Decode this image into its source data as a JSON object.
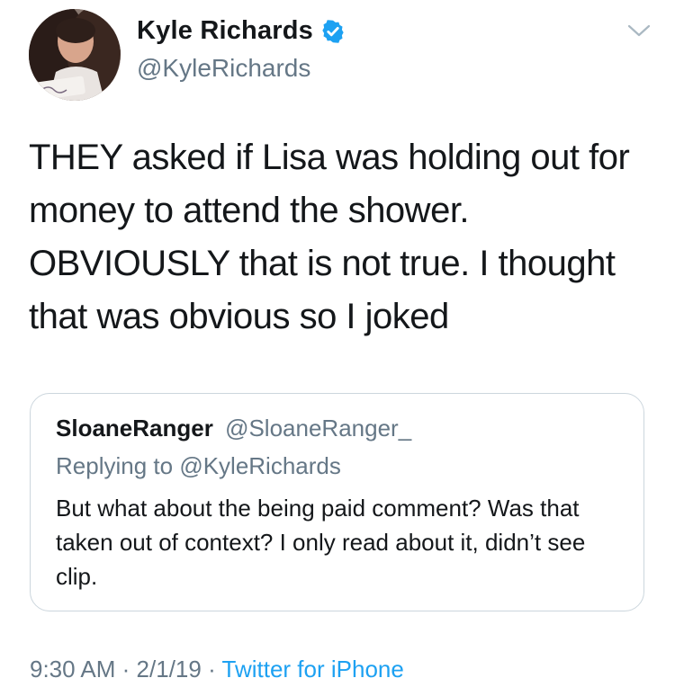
{
  "author": {
    "display_name": "Kyle Richards",
    "handle": "@KyleRichards",
    "verified": true,
    "avatar_caption": "Kyle Richards"
  },
  "tweet": {
    "text": "THEY asked if Lisa was holding out for money to attend the shower. OBVIOUSLY that is not true. I thought that was obvious so I joked"
  },
  "quoted_tweet": {
    "display_name": "SloaneRanger",
    "handle": "@SloaneRanger_",
    "reply_prefix": "Replying to",
    "reply_to": "@KyleRichards",
    "text": "But what about the being paid comment? Was that taken out of context? I only read about it, didn’t see clip."
  },
  "footer": {
    "time": "9:30 AM",
    "separator": "·",
    "date": "2/1/19",
    "source": "Twitter for iPhone"
  },
  "icons": {
    "verified": "verified-badge-icon",
    "menu": "chevron-down-icon"
  },
  "colors": {
    "accent": "#1da1f2",
    "secondary_text": "#657786",
    "primary_text": "#14171a",
    "border": "#ccd6dd"
  }
}
